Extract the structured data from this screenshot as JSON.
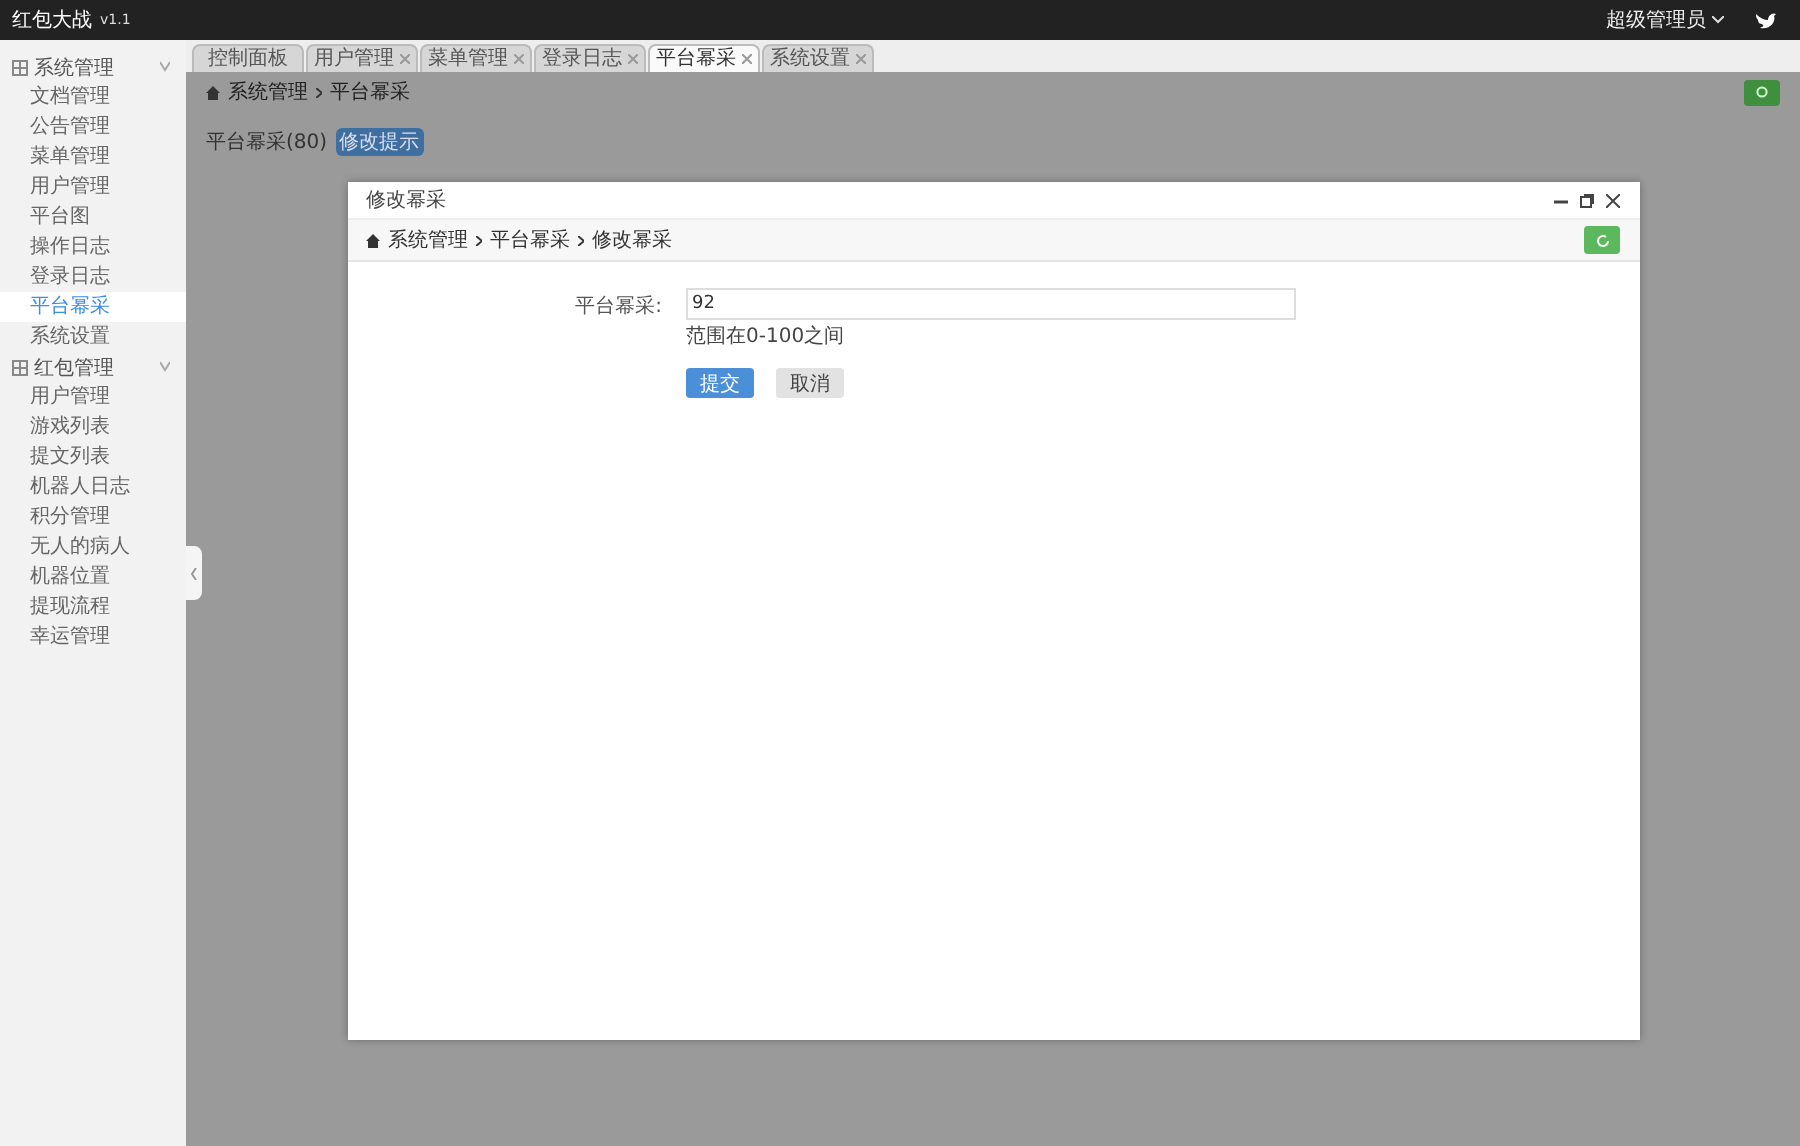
{
  "app": {
    "title": "红包大战",
    "version": "v1.1",
    "user": "超级管理员"
  },
  "sidebar": {
    "groups": [
      {
        "label": "系统管理",
        "expanded": true,
        "items": [
          {
            "label": "文档管理",
            "selected": false
          },
          {
            "label": "公告管理",
            "selected": false
          },
          {
            "label": "菜单管理",
            "selected": false
          },
          {
            "label": "用户管理",
            "selected": false
          },
          {
            "label": "平台图",
            "selected": false
          },
          {
            "label": "操作日志",
            "selected": false
          },
          {
            "label": "登录日志",
            "selected": false
          },
          {
            "label": "平台幂采",
            "selected": true
          },
          {
            "label": "系统设置",
            "selected": false
          }
        ]
      },
      {
        "label": "红包管理",
        "expanded": true,
        "items": [
          {
            "label": "用户管理",
            "selected": false
          },
          {
            "label": "游戏列表",
            "selected": false
          },
          {
            "label": "提文列表",
            "selected": false
          },
          {
            "label": "机器人日志",
            "selected": false
          },
          {
            "label": "积分管理",
            "selected": false
          },
          {
            "label": "无人的病人",
            "selected": false
          },
          {
            "label": "机器位置",
            "selected": false
          },
          {
            "label": "提现流程",
            "selected": false
          },
          {
            "label": "幸运管理",
            "selected": false
          }
        ]
      }
    ]
  },
  "tabs": [
    {
      "label": "控制面板",
      "selected": false,
      "closable": false
    },
    {
      "label": "用户管理",
      "selected": false,
      "closable": true
    },
    {
      "label": "菜单管理",
      "selected": false,
      "closable": true
    },
    {
      "label": "登录日志",
      "selected": false,
      "closable": true
    },
    {
      "label": "平台幂采",
      "selected": true,
      "closable": true
    },
    {
      "label": "系统设置",
      "selected": false,
      "closable": true
    }
  ],
  "breadcrumb": [
    "系统管理",
    "平台幂采"
  ],
  "page": {
    "label": "平台幂采(80)",
    "tag": "修改提示"
  },
  "dialog": {
    "title": "修改幂采",
    "breadcrumb": [
      "系统管理",
      "平台幂采",
      "修改幂采"
    ],
    "field": {
      "label": "平台幂采:",
      "value": "92",
      "hint": "范围在0-100之间"
    },
    "buttons": [
      {
        "label": "提交",
        "kind": "primary"
      },
      {
        "label": "取消",
        "kind": "default"
      }
    ]
  }
}
